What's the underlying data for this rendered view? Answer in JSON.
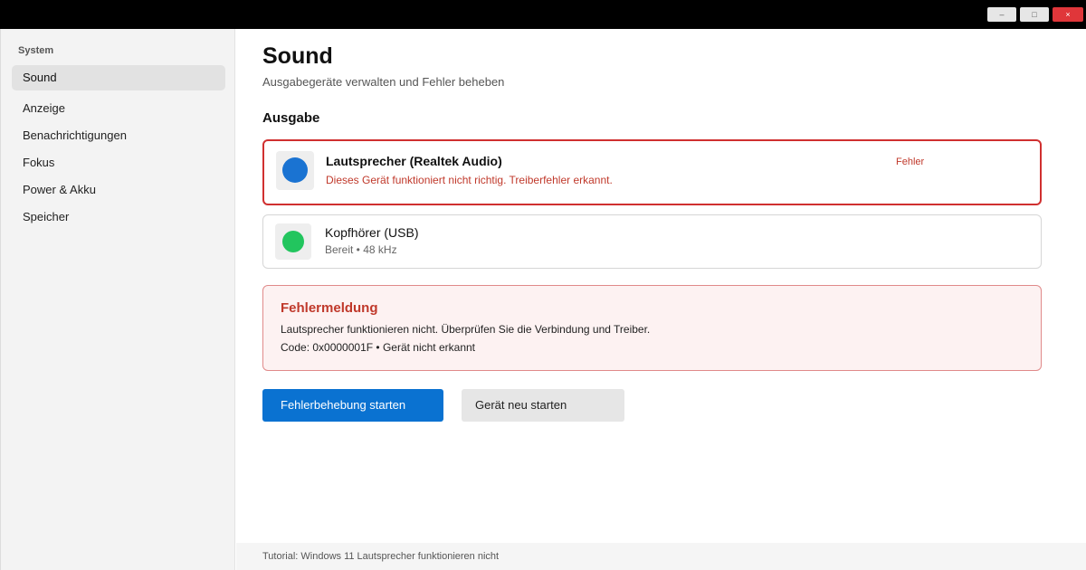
{
  "window": {
    "minimize_glyph": "–",
    "maximize_glyph": "□",
    "close_glyph": "×"
  },
  "sidebar": {
    "section": "System",
    "items": [
      {
        "label": "Sound",
        "active": true
      },
      {
        "label": "Anzeige",
        "active": false
      },
      {
        "label": "Benachrichtigungen",
        "active": false
      },
      {
        "label": "Fokus",
        "active": false
      },
      {
        "label": "Power & Akku",
        "active": false
      },
      {
        "label": "Speicher",
        "active": false
      }
    ]
  },
  "main": {
    "title": "Sound",
    "subtitle": "Ausgabegeräte verwalten und Fehler beheben",
    "section_title": "Ausgabe",
    "devices": [
      {
        "name": "Lautsprecher (Realtek Audio)",
        "status": "Dieses Gerät funktioniert nicht richtig. Treiberfehler erkannt.",
        "badge": "Fehler",
        "icon": "speaker-icon",
        "icon_color": "#1a73d2",
        "state": "error"
      },
      {
        "name": "Kopfhörer (USB)",
        "status": "Bereit • 48 kHz",
        "icon": "headphones-icon",
        "icon_color": "#22c55e",
        "state": "ready"
      }
    ],
    "error_box": {
      "title": "Fehlermeldung",
      "line1": "Lautsprecher funktionieren nicht. Überprüfen Sie die Verbindung und Treiber.",
      "line2": "Code: 0x0000001F • Gerät nicht erkannt"
    },
    "buttons": {
      "troubleshoot": "Fehlerbehebung starten",
      "restart": "Gerät neu starten"
    }
  },
  "footer": {
    "text": "Tutorial: Windows 11 Lautsprecher funktionieren nicht"
  },
  "colors": {
    "accent": "#0a72d1",
    "error": "#c0392b",
    "error_border": "#d03030",
    "success": "#22c55e"
  }
}
